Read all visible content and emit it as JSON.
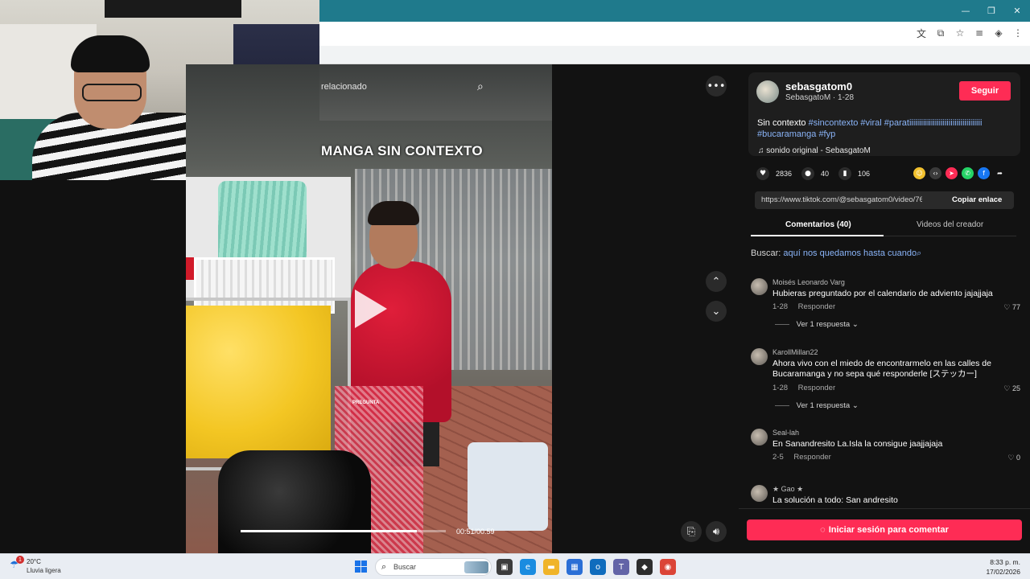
{
  "browser": {
    "window_controls": [
      "—",
      "❐",
      "✕"
    ]
  },
  "video": {
    "related_label": "relacionado",
    "caption": "MANGA SIN CONTEXTO",
    "sticker_text": "PREGUNTA",
    "time": "00:51/00:59",
    "progress": 0.86
  },
  "author": {
    "username": "sebasgatom0",
    "subline": "SebasgatoM · 1-28",
    "follow_label": "Seguir"
  },
  "description": {
    "text": "Sin contexto",
    "hashtags_line1": "#sincontexto #viral #parati",
    "hashtag_long": "iiiiiiiiiiiiiiiiiiiiiiiiiiiiiiiiiiii",
    "hashtags_line2": "#bucaramanga #fyp",
    "sound": "sonido original - SebasgatoM"
  },
  "stats": {
    "likes": "2836",
    "comments": "40",
    "saves": "106"
  },
  "share": {
    "link": "https://www.tiktok.com/@sebasgatom0/video/760...",
    "copy_label": "Copiar enlace"
  },
  "tabs": {
    "comments": "Comentarios (40)",
    "creator_videos": "Videos del creador"
  },
  "search": {
    "prefix": "Buscar:",
    "query": "aquí nos quedamos hasta cuando"
  },
  "comments": [
    {
      "author": "Moisés Leonardo Varg",
      "text": "Hubieras preguntado por el calendario de adviento jajajjaja",
      "date": "1-28",
      "reply": "Responder",
      "likes": "77",
      "replies": "Ver 1 respuesta"
    },
    {
      "author": "KarollMillan22",
      "text": "Ahora vivo con el miedo de encontrarmelo en las calles de Bucaramanga y no sepa qué responderle [ステッカー]",
      "date": "1-28",
      "reply": "Responder",
      "likes": "25",
      "replies": "Ver 1 respuesta"
    },
    {
      "author": "Seal-lah",
      "text": "En Sanandresito La.Isla la consigue jaajjajaja",
      "date": "2-5",
      "reply": "Responder",
      "likes": "0"
    },
    {
      "author": "★ Gao ★",
      "text": "La solución a todo: San andresito"
    }
  ],
  "login_label": "Iniciar sesión para comentar",
  "taskbar": {
    "weather_badge": "1",
    "temperature": "20°C",
    "weather_desc": "Lluvia ligera",
    "search_placeholder": "Buscar",
    "time": "8:33 p. m.",
    "date": "17/02/2026"
  },
  "colors": {
    "accent": "#fe2c55",
    "hashtag": "#8ab4f8",
    "titlebar": "#1f7a8c"
  }
}
